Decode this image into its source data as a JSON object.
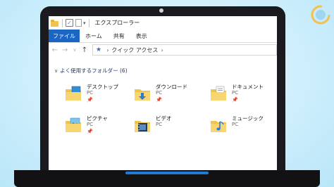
{
  "window": {
    "title": "エクスプローラー"
  },
  "ribbon": {
    "tabs": [
      "ファイル",
      "ホーム",
      "共有",
      "表示"
    ]
  },
  "nav": {
    "back": "←",
    "forward": "→",
    "recent": "∨",
    "up": "↑"
  },
  "address": {
    "path": "クイック アクセス",
    "separator": "›"
  },
  "quick_access": {
    "group_title": "よく使用するフォルダー (6)",
    "folders": [
      {
        "name": "デスクトップ",
        "location": "PC",
        "pin": "📌",
        "icon": "desktop-folder-icon"
      },
      {
        "name": "ダウンロード",
        "location": "PC",
        "pin": "📌",
        "icon": "download-folder-icon"
      },
      {
        "name": "ドキュメント",
        "location": "PC",
        "pin": "📌",
        "icon": "documents-folder-icon"
      },
      {
        "name": "ピクチャ",
        "location": "PC",
        "pin": "📌",
        "icon": "pictures-folder-icon"
      },
      {
        "name": "ビデオ",
        "location": "PC",
        "pin": "",
        "icon": "videos-folder-icon"
      },
      {
        "name": "ミュージック",
        "location": "PC",
        "pin": "",
        "icon": "music-folder-icon"
      }
    ]
  },
  "colors": {
    "accent": "#1a66c2",
    "folder": "#f0c44c",
    "background": "#cdeefc",
    "laptop": "#1b1b1f"
  }
}
